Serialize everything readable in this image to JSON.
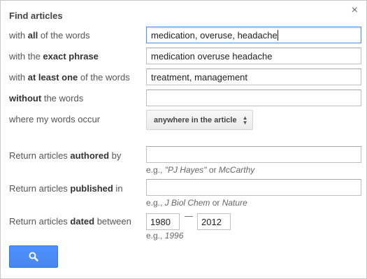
{
  "dialog": {
    "title": "Find articles",
    "close_glyph": "×"
  },
  "rows": {
    "all_words": {
      "prefix": "with ",
      "bold": "all",
      "suffix": " of the words",
      "value": "medication, overuse, headache"
    },
    "exact_phrase": {
      "prefix": "with the ",
      "bold": "exact phrase",
      "suffix": "",
      "value": "medication overuse headache"
    },
    "at_least_one": {
      "prefix": "with ",
      "bold": "at least one",
      "suffix": " of the words",
      "value": "treatment, management"
    },
    "without": {
      "prefix": "",
      "bold": "without",
      "suffix": " the words",
      "value": ""
    },
    "occur": {
      "label": "where my words occur",
      "selected": "anywhere in the article"
    }
  },
  "authored": {
    "prefix": "Return articles ",
    "bold": "authored",
    "suffix": " by",
    "value": "",
    "hint_prefix": "e.g., ",
    "hint_italic": "\"PJ Hayes\"",
    "hint_mid": " or ",
    "hint_italic2": "McCarthy"
  },
  "published": {
    "prefix": "Return articles ",
    "bold": "published",
    "suffix": " in",
    "value": "",
    "hint_prefix": "e.g., ",
    "hint_italic": "J Biol Chem",
    "hint_mid": " or ",
    "hint_italic2": "Nature"
  },
  "dated": {
    "prefix": "Return articles ",
    "bold": "dated",
    "suffix": " between",
    "from": "1980",
    "to": "2012",
    "hint_prefix": "e.g., ",
    "hint_italic": "1996"
  },
  "search_button": {
    "icon": "search-icon",
    "color": "#4d90fe"
  }
}
